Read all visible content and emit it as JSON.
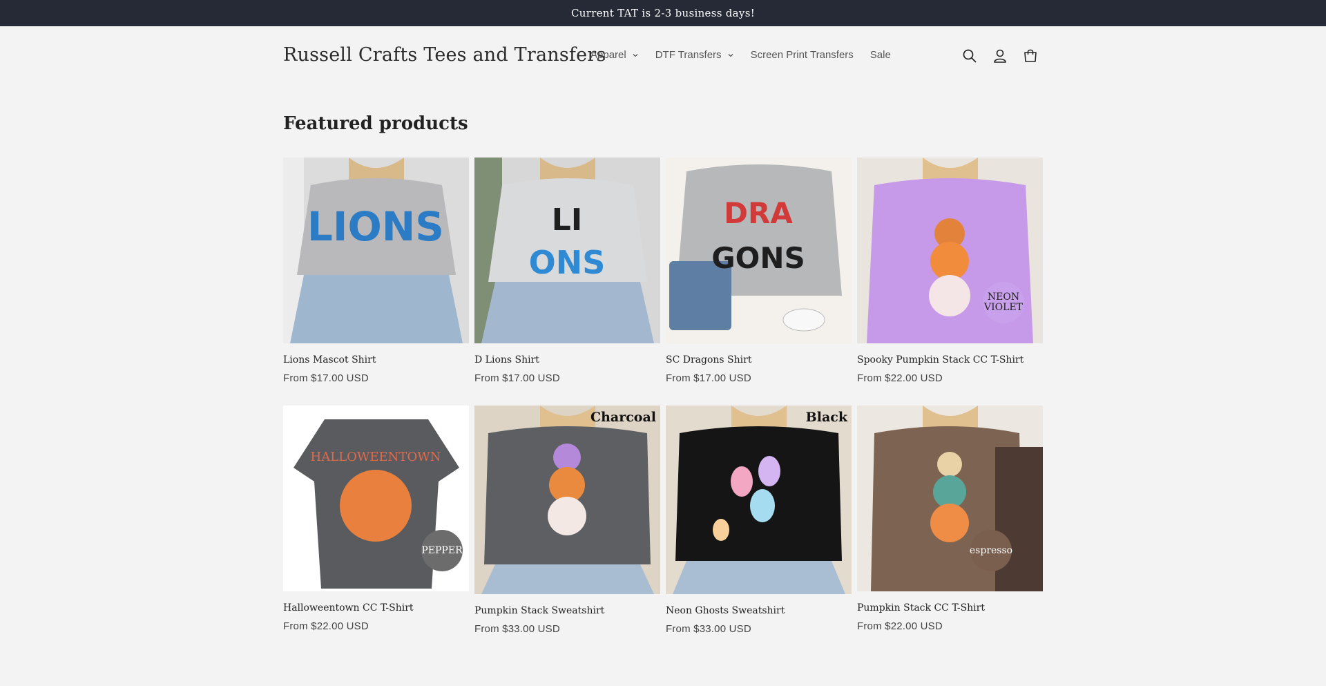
{
  "announcement": {
    "text": "Current TAT is 2-3 business days!"
  },
  "header": {
    "logo": "Russell Crafts Tees and Transfers",
    "nav": [
      {
        "label": "Apparel",
        "has_dropdown": true
      },
      {
        "label": "DTF Transfers",
        "has_dropdown": true
      },
      {
        "label": "Screen Print Transfers",
        "has_dropdown": false
      },
      {
        "label": "Sale",
        "has_dropdown": false
      }
    ],
    "icons": [
      "search-icon",
      "account-icon",
      "cart-icon"
    ]
  },
  "featured": {
    "title": "Featured products",
    "products": [
      {
        "name": "Lions Mascot Shirt",
        "price": "From $17.00 USD",
        "badge": ""
      },
      {
        "name": "D Lions Shirt",
        "price": "From $17.00 USD",
        "badge": ""
      },
      {
        "name": "SC Dragons Shirt",
        "price": "From $17.00 USD",
        "badge": ""
      },
      {
        "name": "Spooky Pumpkin Stack CC T-Shirt",
        "price": "From $22.00 USD",
        "badge": "NEON VIOLET"
      },
      {
        "name": "Halloweentown CC T-Shirt",
        "price": "From $22.00 USD",
        "badge": "PEPPER"
      },
      {
        "name": "Pumpkin Stack Sweatshirt",
        "price": "From $33.00 USD",
        "badge": "Charcoal"
      },
      {
        "name": "Neon Ghosts Sweatshirt",
        "price": "From $33.00 USD",
        "badge": "Black"
      },
      {
        "name": "Pumpkin Stack CC T-Shirt",
        "price": "From $22.00 USD",
        "badge": "espresso"
      }
    ]
  },
  "colors": {
    "announcement_bg": "#252a36",
    "page_bg": "#f3f3f3"
  }
}
